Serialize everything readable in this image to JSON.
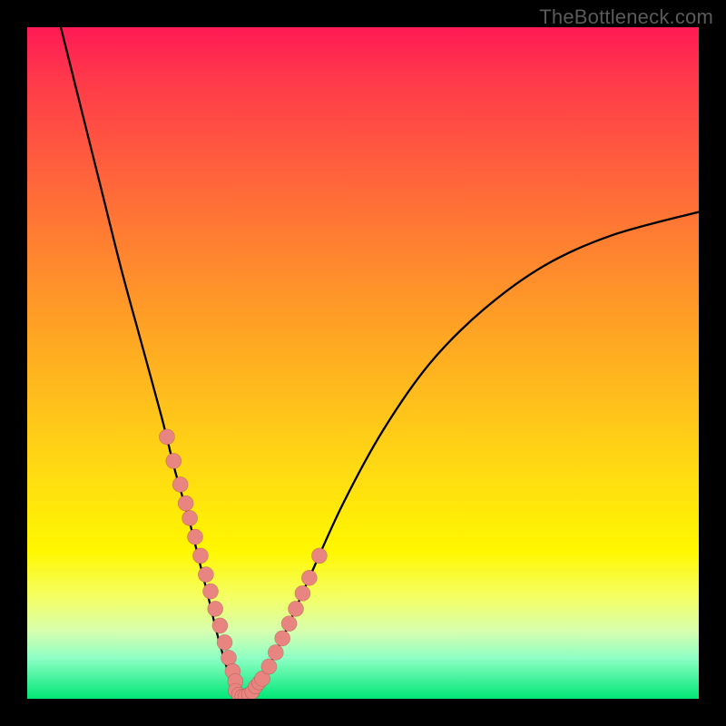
{
  "watermark": "TheBottleneck.com",
  "chart_data": {
    "type": "line",
    "title": "",
    "xlabel": "",
    "ylabel": "",
    "xlim": [
      0,
      100
    ],
    "ylim": [
      0,
      100
    ],
    "curve": {
      "x": [
        5,
        8,
        11,
        14,
        17,
        20,
        22,
        24,
        25.5,
        27,
        28.2,
        29.3,
        30.3,
        31.2,
        32,
        33,
        35,
        38,
        42,
        47,
        53,
        60,
        68,
        77,
        87,
        100
      ],
      "y": [
        100,
        88,
        76,
        64,
        53,
        42,
        34,
        27,
        21,
        15,
        10,
        6,
        3,
        1.2,
        0.35,
        0.6,
        3,
        9,
        18,
        29,
        40,
        50,
        58,
        64.5,
        69,
        72.5
      ]
    },
    "markers_left": {
      "x": [
        20.8,
        21.8,
        22.8,
        23.6,
        24.2,
        25.0,
        25.8,
        26.6,
        27.3,
        28.0,
        28.7,
        29.4,
        30.0,
        30.6,
        31.0
      ],
      "y": [
        39.0,
        35.4,
        31.9,
        29.1,
        26.9,
        24.1,
        21.3,
        18.5,
        16.0,
        13.4,
        10.9,
        8.4,
        6.1,
        4.1,
        2.6
      ]
    },
    "markers_bottom": {
      "x": [
        31.0,
        31.5,
        32.0,
        32.5,
        33.0,
        33.5,
        34.0,
        34.5
      ],
      "y": [
        1.2,
        0.65,
        0.35,
        0.4,
        0.6,
        1.0,
        1.8,
        2.4
      ]
    },
    "markers_right": {
      "x": [
        35.0,
        36.0,
        37.0,
        38.0,
        39.0,
        40.0,
        41.0,
        42.0,
        43.5
      ],
      "y": [
        3.0,
        4.8,
        6.9,
        9.0,
        11.2,
        13.4,
        15.7,
        18.0,
        21.3
      ]
    }
  }
}
